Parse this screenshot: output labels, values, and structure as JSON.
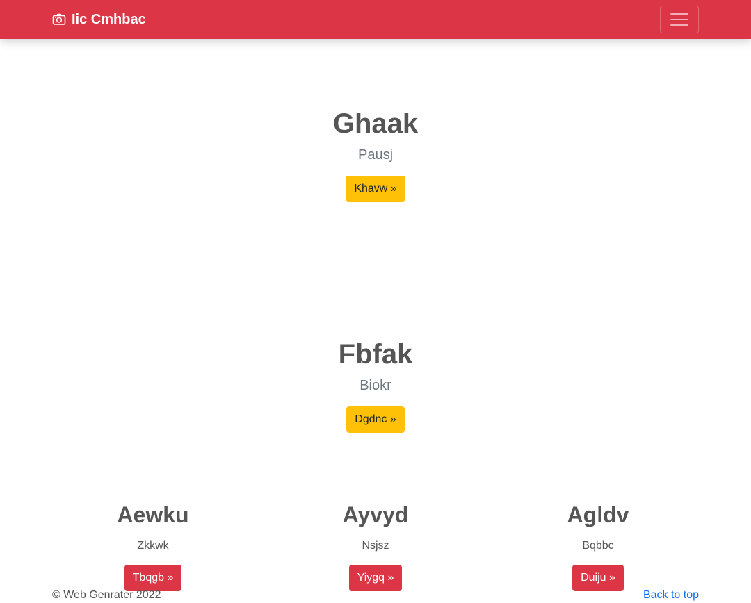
{
  "navbar": {
    "brand_icon": "camera-icon",
    "brand": "Iic Cmhbac",
    "toggler_icon": "hamburger-menu-icon",
    "color": "#dc3545"
  },
  "heroes": [
    {
      "title": "Ghaak",
      "subtitle": "Pausj",
      "button": "Khavw »"
    },
    {
      "title": "Fbfak",
      "subtitle": "Biokr",
      "button": "Dgdnc »"
    }
  ],
  "features": [
    {
      "title": "Aewku",
      "text": "Zkkwk",
      "button": "Tbqgb »"
    },
    {
      "title": "Ayvyd",
      "text": "Nsjsz",
      "button": "Yiygq »"
    },
    {
      "title": "Agldv",
      "text": "Bqbbc",
      "button": "Duiju »"
    }
  ],
  "footer": {
    "copyright": "© Web Genrater 2022",
    "back_to_top": "Back to top"
  },
  "colors": {
    "primary_red": "#dc3545",
    "warning_yellow": "#ffc107",
    "link_blue": "#0d6efd"
  }
}
